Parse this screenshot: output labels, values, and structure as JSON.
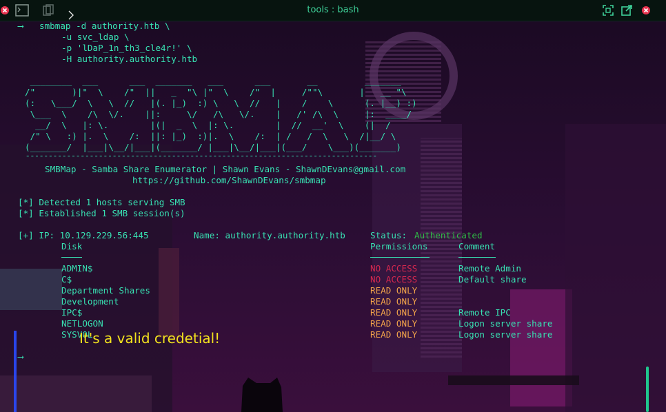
{
  "window": {
    "title": "tools : bash"
  },
  "prompt": {
    "arrow": "⟶"
  },
  "command": [
    "smbmap -d authority.htb \\",
    "-u svc_ldap \\",
    "-p 'lDaP_1n_th3_cle4r!' \\",
    "-H authority.authority.htb"
  ],
  "banner": {
    "ascii": [
      " ________  ___      ___  _______   ___      ___       __         _______",
      "/\"       )|\"  \\    /\"  ||   _  \"\\ |\"  \\    /\"  |     /\"\"\\       |   __ \"\\",
      "(:   \\___/  \\   \\  //   |(. |_)  :) \\   \\  //   |    /    \\      (. |__) :)",
      " \\___  \\    /\\  \\/.    ||:     \\/   /\\   \\/.    |   /' /\\  \\     |:  ____/",
      "  __/  \\   |: \\.        |(|  _  \\  |: \\.        |  //  __'  \\    (|  /",
      " /\" \\   :) |.  \\    /:  ||: |_)  :)|.  \\    /:  | /   /  \\   \\  /|__/ \\",
      "(_______/  |___|\\__/|___|(_______/ |___|\\__/|___|(___/    \\___)(_______)",
      " -----------------------------------------------------------------------------"
    ],
    "credit": "SMBMap - Samba Share Enumerator | Shawn Evans - ShawnDEvans@gmail.com",
    "url": "https://github.com/ShawnDEvans/smbmap"
  },
  "status_lines": [
    "[*] Detected 1 hosts serving SMB",
    "[*] Established 1 SMB session(s)"
  ],
  "host": {
    "prefix": "[+] IP: 10.129.229.56:445",
    "name": "Name: authority.authority.htb",
    "status_label": "Status:",
    "status_value": "Authenticated"
  },
  "table": {
    "headers": {
      "disk": "Disk",
      "permissions": "Permissions",
      "comment": "Comment"
    },
    "rows": [
      {
        "disk": "ADMIN$",
        "permissions": "NO ACCESS",
        "comment": "Remote Admin"
      },
      {
        "disk": "C$",
        "permissions": "NO ACCESS",
        "comment": "Default share"
      },
      {
        "disk": "Department Shares",
        "permissions": "READ ONLY",
        "comment": ""
      },
      {
        "disk": "Development",
        "permissions": "READ ONLY",
        "comment": ""
      },
      {
        "disk": "IPC$",
        "permissions": "READ ONLY",
        "comment": "Remote IPC"
      },
      {
        "disk": "NETLOGON",
        "permissions": "READ ONLY",
        "comment": "Logon server share"
      },
      {
        "disk": "SYSVOL",
        "permissions": "READ ONLY",
        "comment": "Logon server share"
      }
    ]
  },
  "annotation": "It's a valid credetial!",
  "colors": {
    "text": "#38e2b3",
    "no_access": "#d7284f",
    "read_only": "#f0a24a",
    "authenticated": "#2fbd46",
    "annotation": "#f3e21e"
  },
  "icons": {
    "close_left": "close-icon",
    "terminal": "terminal-icon",
    "copy": "copy-icon",
    "chevron": "chevron-right-icon",
    "maximize": "maximize-icon",
    "detach": "detach-icon",
    "close_right": "close-icon"
  }
}
